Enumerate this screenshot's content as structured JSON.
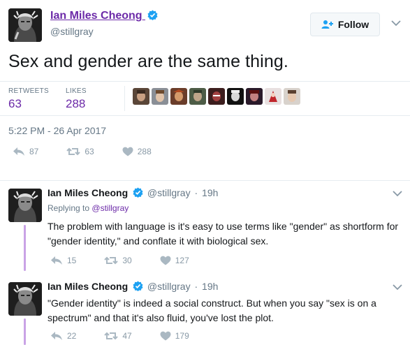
{
  "tweet": {
    "author_name": "Ian Miles Cheong",
    "author_handle": "@stillgray",
    "follow_label": "Follow",
    "text": "Sex and gender are the same thing.",
    "retweets_label": "RETWEETS",
    "retweets_count": "63",
    "likes_label": "LIKES",
    "likes_count": "288",
    "timestamp": "5:22 PM - 26 Apr 2017",
    "actions": {
      "reply": "87",
      "retweet": "63",
      "like": "288"
    }
  },
  "replies": [
    {
      "author_name": "Ian Miles Cheong",
      "author_handle": "@stillgray",
      "age": "19h",
      "replying_prefix": "Replying to",
      "replying_to": "@stillgray",
      "text": "The problem with language is it's easy to use terms like \"gender\" as shortform for \"gender identity,\" and conflate it with biological sex.",
      "actions": {
        "reply": "15",
        "retweet": "30",
        "like": "127"
      }
    },
    {
      "author_name": "Ian Miles Cheong",
      "author_handle": "@stillgray",
      "age": "19h",
      "text": "\"Gender identity\" is indeed a social construct. But when you say \"sex is on a spectrum\" and that it's also fluid, you've lost the plot.",
      "actions": {
        "reply": "22",
        "retweet": "47",
        "like": "179"
      }
    }
  ],
  "colors": {
    "accent": "#6c2aa8",
    "verified": "#1da1f2",
    "thread_line": "#c9a3e6",
    "muted": "#657786"
  },
  "icons": [
    "verified-badge-icon",
    "add-user-icon",
    "chevron-down-icon",
    "reply-icon",
    "retweet-icon",
    "heart-icon"
  ]
}
